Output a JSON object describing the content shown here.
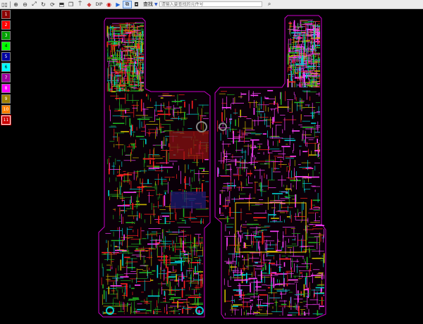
{
  "toolbar": {
    "search_label": "查找",
    "search_placeholder": "请输入要查找的元件号",
    "tools": [
      "fit-page-icon",
      "zoom-in-icon",
      "zoom-out-icon",
      "fit-width-icon",
      "refresh-icon",
      "rotate-icon",
      "flip-icon",
      "copy-icon",
      "pin-icon",
      "gem-icon",
      "dip-icon",
      "component-icon",
      "select-icon",
      "net-icon",
      "mouse-icon"
    ],
    "dip_label": "DIP"
  },
  "layers": [
    {
      "label": "1",
      "color": "#8b0000"
    },
    {
      "label": "2",
      "color": "#ff0000"
    },
    {
      "label": "3",
      "color": "#00a000"
    },
    {
      "label": "4",
      "color": "#00ff00"
    },
    {
      "label": "5",
      "color": "#0000a0"
    },
    {
      "label": "6",
      "color": "#00ffff"
    },
    {
      "label": "7",
      "color": "#a000a0"
    },
    {
      "label": "8",
      "color": "#ff00ff"
    },
    {
      "label": "9",
      "color": "#a08000"
    },
    {
      "label": "10",
      "color": "#ff8000"
    },
    {
      "label": "11",
      "color": "#cc0000"
    }
  ],
  "colors": {
    "outline": "#c800c8",
    "trace_red": "#ff2020",
    "trace_green": "#20b020",
    "trace_magenta": "#ff40ff",
    "trace_yellow": "#c8b400",
    "trace_cyan": "#00d0d0"
  }
}
